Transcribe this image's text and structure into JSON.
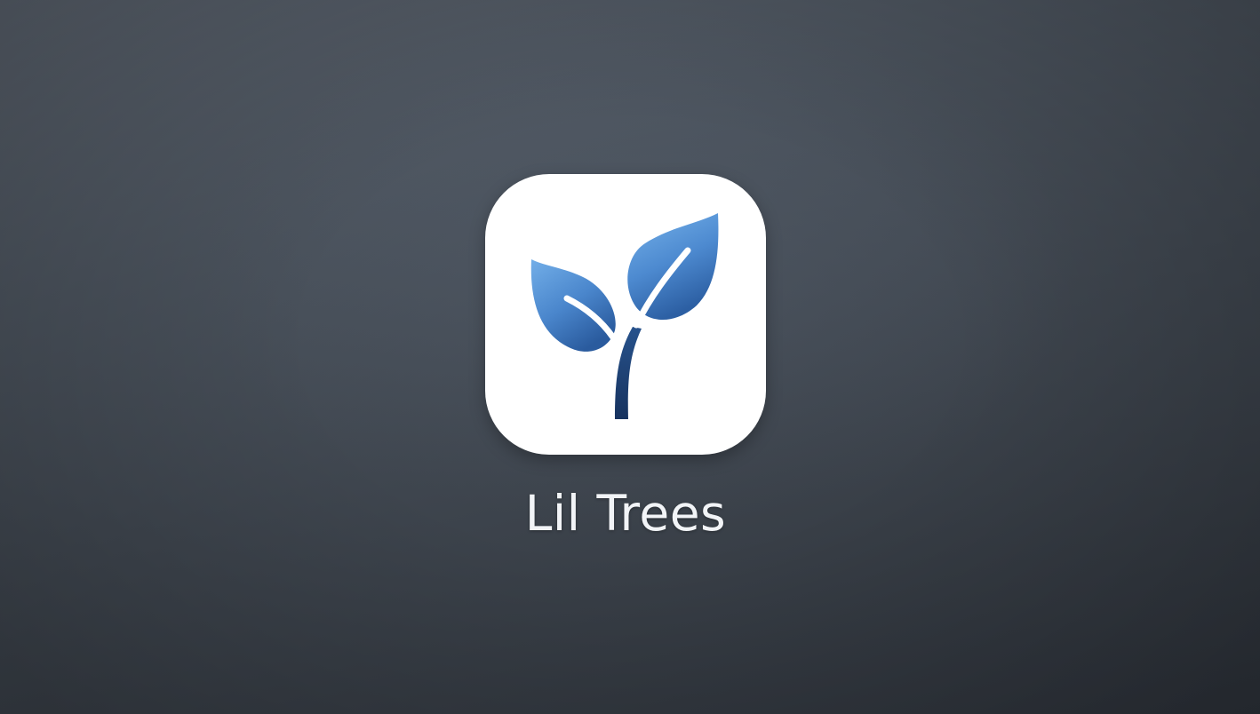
{
  "home_screen": {
    "app": {
      "label": "Lil Trees",
      "icon": "sprout-icon",
      "colors": {
        "icon_background": "#ffffff",
        "leaf_light": "#6aa6e0",
        "leaf_dark": "#2e64a8",
        "stem": "#1c3f72",
        "label": "#f2f4f7"
      }
    },
    "wallpaper": {
      "colors": [
        "#5a626d",
        "#3f464f",
        "#2d323a"
      ]
    }
  }
}
